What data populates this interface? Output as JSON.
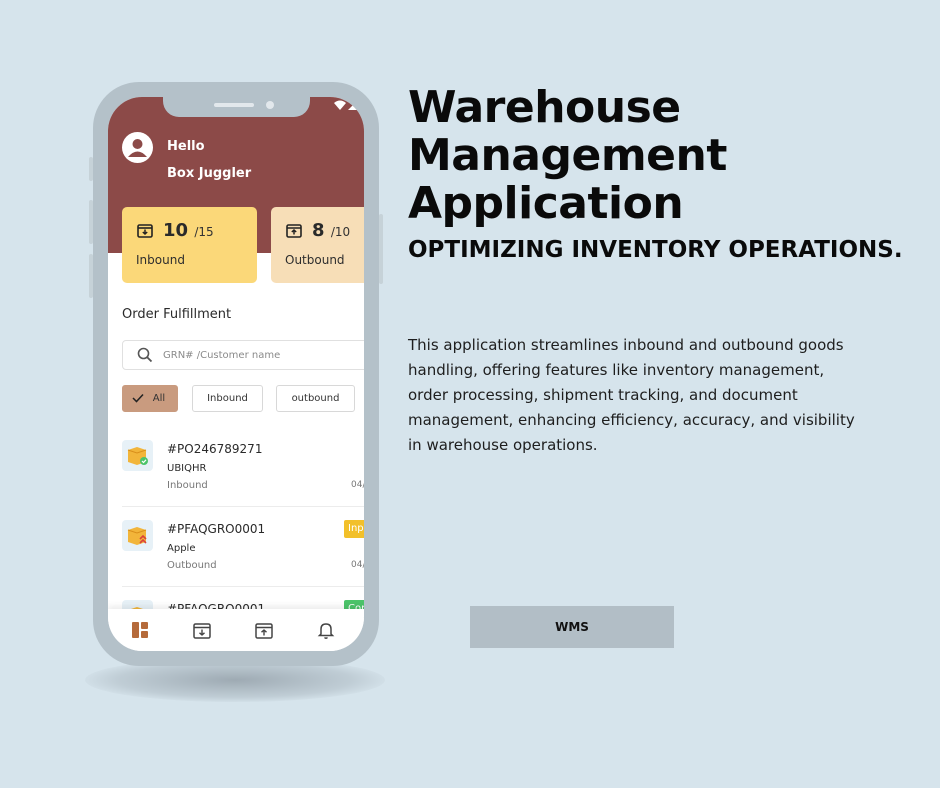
{
  "phone": {
    "greeting": "Hello",
    "username": "Box Juggler",
    "stats": {
      "inbound": {
        "count": "10",
        "total": "/15",
        "label": "Inbound",
        "color": "#fbd879"
      },
      "outbound": {
        "count": "8",
        "total": "/10",
        "label": "Outbound",
        "color": "#f7deb7"
      }
    },
    "section_title": "Order Fulfillment",
    "search": {
      "placeholder": "GRN# /Customer name"
    },
    "filters": [
      "All",
      "Inbound",
      "outbound"
    ],
    "orders": [
      {
        "id": "#PO246789271",
        "customer": "UBIQHR",
        "type": "Inbound",
        "date": "04/",
        "badge": ""
      },
      {
        "id": "#PFAQGRO0001",
        "customer": "Apple",
        "type": "Outbound",
        "date": "04/",
        "badge": "Inp"
      },
      {
        "id": "#PFAQGRO0001",
        "customer": "",
        "type": "",
        "date": "",
        "badge": "Cor"
      }
    ],
    "tabs": [
      "dashboard-icon",
      "inbound-box-icon",
      "outbound-box-icon",
      "bell-icon"
    ],
    "header_color": "#8c4a48",
    "accent_chip_color": "#c99b7f"
  },
  "hero": {
    "title": "Warehouse Management Application",
    "subtitle": "OPTIMIZING INVENTORY OPERATIONS.",
    "description": "This application streamlines inbound and outbound goods handling, offering features like inventory management, order processing, shipment tracking, and document management, enhancing efficiency, accuracy, and visibility in warehouse operations.",
    "button_label": "WMS"
  }
}
